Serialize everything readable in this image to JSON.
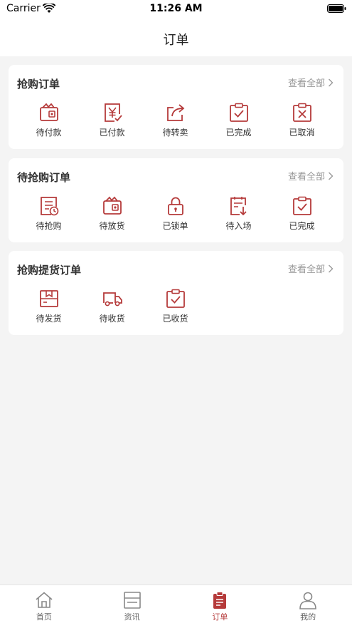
{
  "status_bar": {
    "carrier": "Carrier",
    "time": "11:26 AM"
  },
  "nav": {
    "title": "订单"
  },
  "accent_color": "#b53a3a",
  "sections": [
    {
      "title": "抢购订单",
      "view_all": "查看全部",
      "items": [
        {
          "label": "待付款",
          "icon": "wallet-icon"
        },
        {
          "label": "已付款",
          "icon": "yen-check-icon"
        },
        {
          "label": "待转卖",
          "icon": "share-icon"
        },
        {
          "label": "已完成",
          "icon": "clipboard-check-icon"
        },
        {
          "label": "已取消",
          "icon": "clipboard-x-icon"
        }
      ]
    },
    {
      "title": "待抢购订单",
      "view_all": "查看全部",
      "items": [
        {
          "label": "待抢购",
          "icon": "list-clock-icon"
        },
        {
          "label": "待放货",
          "icon": "wallet-icon"
        },
        {
          "label": "已锁单",
          "icon": "lock-icon"
        },
        {
          "label": "待入场",
          "icon": "download-doc-icon"
        },
        {
          "label": "已完成",
          "icon": "clipboard-check-icon"
        }
      ]
    },
    {
      "title": "抢购提货订单",
      "view_all": "查看全部",
      "items": [
        {
          "label": "待发货",
          "icon": "box-icon"
        },
        {
          "label": "待收货",
          "icon": "truck-icon"
        },
        {
          "label": "已收货",
          "icon": "clipboard-check-icon"
        }
      ]
    }
  ],
  "tab_bar": {
    "tabs": [
      {
        "label": "首页",
        "icon": "home-icon",
        "active": false
      },
      {
        "label": "资讯",
        "icon": "news-icon",
        "active": false
      },
      {
        "label": "订单",
        "icon": "order-icon",
        "active": true
      },
      {
        "label": "我的",
        "icon": "user-icon",
        "active": false
      }
    ]
  }
}
